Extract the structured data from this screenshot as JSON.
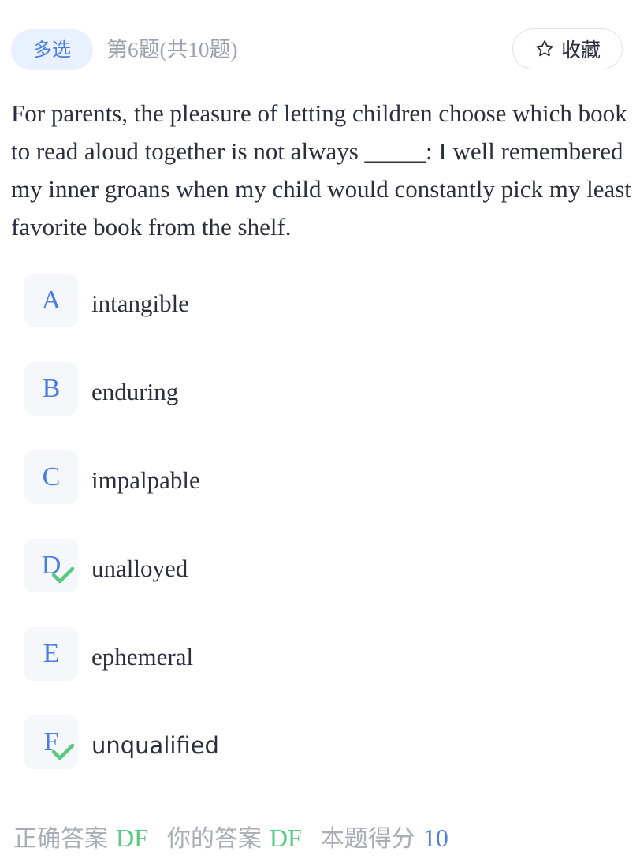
{
  "header": {
    "type_badge": "多选",
    "progress": "第6题(共10题)",
    "favorite_label": "收藏"
  },
  "question": {
    "text": "For parents, the pleasure of letting children choose which book to read aloud together is not always _____: I well remembered my inner groans when my child would constantly pick my least favorite book from the shelf."
  },
  "options": [
    {
      "letter": "A",
      "text": "intangible",
      "correct": false
    },
    {
      "letter": "B",
      "text": "enduring",
      "correct": false
    },
    {
      "letter": "C",
      "text": "impalpable",
      "correct": false
    },
    {
      "letter": "D",
      "text": "unalloyed",
      "correct": true
    },
    {
      "letter": "E",
      "text": "ephemeral",
      "correct": false
    },
    {
      "letter": "F",
      "text": "unqualified",
      "correct": true
    }
  ],
  "footer": {
    "correct_answer_label": "正确答案",
    "correct_answer": "DF",
    "your_answer_label": "你的答案",
    "your_answer": "DF",
    "score_label": "本题得分",
    "score": "10"
  },
  "colors": {
    "accent": "#4a7fe0",
    "correct": "#58c97f",
    "muted": "#a9adb5"
  },
  "icons": {
    "favorite": "star-outline-icon",
    "correct_mark": "check-icon"
  }
}
